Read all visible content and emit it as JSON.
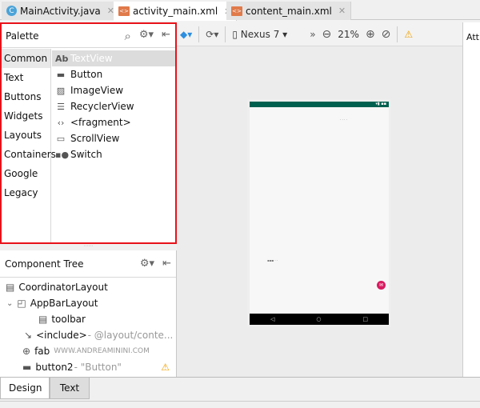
{
  "tabs": [
    {
      "label": "MainActivity.java",
      "icon": "c-class-icon"
    },
    {
      "label": "activity_main.xml",
      "icon": "xml-file-icon",
      "active": true
    },
    {
      "label": "content_main.xml",
      "icon": "xml-file-icon"
    }
  ],
  "palette": {
    "title": "Palette",
    "categories": [
      "Common",
      "Text",
      "Buttons",
      "Widgets",
      "Layouts",
      "Containers",
      "Google",
      "Legacy"
    ],
    "selected_category": "Common",
    "items": [
      {
        "label": "TextView",
        "icon": "Ab"
      },
      {
        "label": "Button",
        "icon": "button-icon"
      },
      {
        "label": "ImageView",
        "icon": "image-icon"
      },
      {
        "label": "RecyclerView",
        "icon": "list-icon"
      },
      {
        "label": "<fragment>",
        "icon": "code-icon"
      },
      {
        "label": "ScrollView",
        "icon": "scroll-icon"
      },
      {
        "label": "Switch",
        "icon": "switch-icon"
      }
    ]
  },
  "toolbar": {
    "device": "Nexus 7",
    "zoom": "21%"
  },
  "attributes": {
    "title": "Attributes"
  },
  "tree": {
    "title": "Component Tree",
    "rows": [
      {
        "label": "CoordinatorLayout",
        "detail": ""
      },
      {
        "label": "AppBarLayout",
        "detail": ""
      },
      {
        "label": "toolbar",
        "detail": ""
      },
      {
        "label": "<include>",
        "detail": "- @layout/conte..."
      },
      {
        "label": "fab",
        "detail": "WWW.ANDREAMININI.COM"
      },
      {
        "label": "button2",
        "detail": "- \"Button\""
      }
    ]
  },
  "bottom_tabs": {
    "design": "Design",
    "text": "Text"
  },
  "colors": {
    "highlight": "#e8121a",
    "statusbar": "#006050",
    "fab": "#d81b60",
    "warning": "#f0a000"
  }
}
